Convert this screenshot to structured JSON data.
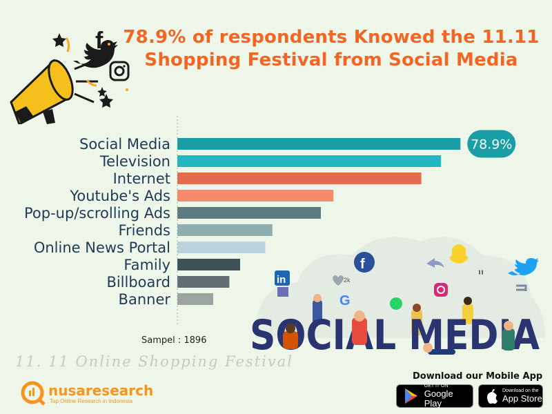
{
  "title": {
    "line1": "78.9% of respondents Knowed the 11.11",
    "line2": "Shopping Festival  from Social Media"
  },
  "chart_data": {
    "type": "bar",
    "orientation": "horizontal",
    "categories": [
      "Social Media",
      "Television",
      "Internet",
      "Youtube's Ads",
      "Pop-up/scrolling Ads",
      "Friends",
      "Online News Portal",
      "Family",
      "Billboard",
      "Banner"
    ],
    "values": [
      78.9,
      73.5,
      68.0,
      43.5,
      40.0,
      26.5,
      24.5,
      17.5,
      14.5,
      10.0
    ],
    "colors": [
      "#1a9ea6",
      "#22b7c0",
      "#e36b50",
      "#f58b68",
      "#5c7b7f",
      "#8faeb1",
      "#b9d4dc",
      "#3e5257",
      "#616d70",
      "#9ba3a3"
    ],
    "data_labels": [
      {
        "index": 0,
        "text": "78.9%"
      }
    ],
    "xlim": [
      0,
      100
    ],
    "grid": false
  },
  "sample": "Sampel : 1896",
  "watermark": "11. 11 Online Shopping Festival",
  "illustration": {
    "word": "SOCIAL MEDIA",
    "icons": [
      "megaphone-icon",
      "facebook-icon",
      "twitter-icon",
      "instagram-icon",
      "linkedin-icon",
      "google-icon",
      "whatsapp-icon",
      "snapchat-icon",
      "share-icon",
      "heart-icon",
      "quote-icon",
      "retweet-icon"
    ],
    "like_count": "2k"
  },
  "brand": {
    "name": "nusaresearch",
    "tagline": "Top Online Research in Indonesia",
    "color": "#f7941d"
  },
  "download": {
    "label": "Download our Mobile App",
    "google": {
      "small": "GET IT ON",
      "big": "Google Play"
    },
    "apple": {
      "small": "Download on the",
      "big": "App Store"
    }
  }
}
